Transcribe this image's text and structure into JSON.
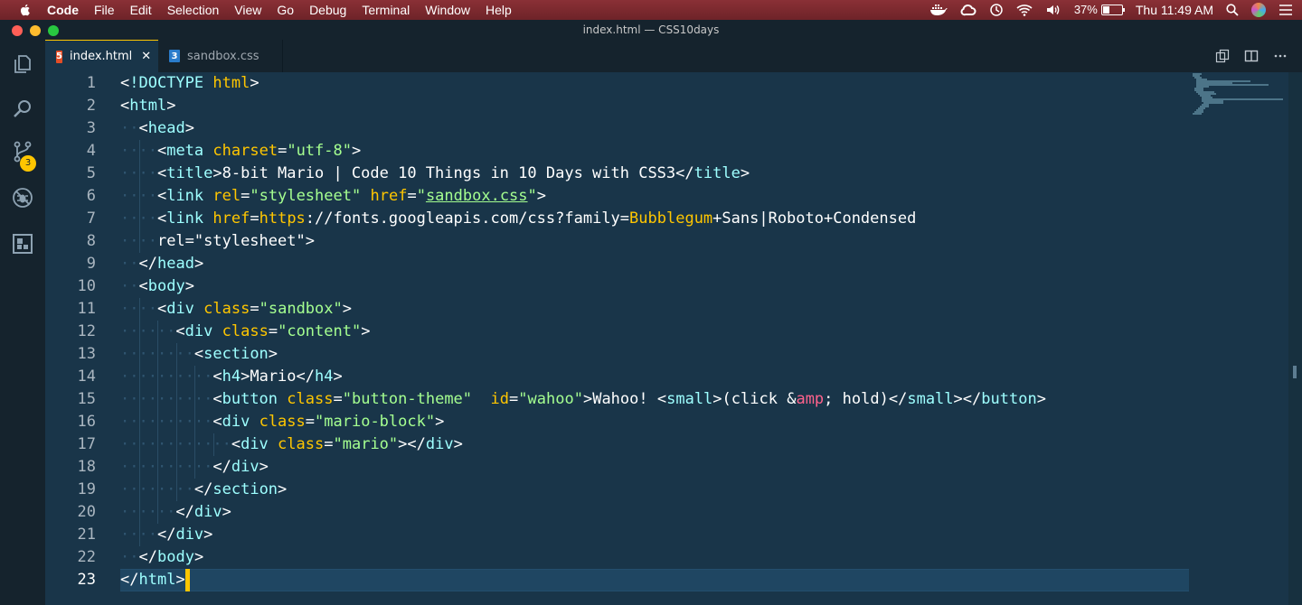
{
  "menubar": {
    "app": "Code",
    "items": [
      "File",
      "Edit",
      "Selection",
      "View",
      "Go",
      "Debug",
      "Terminal",
      "Window",
      "Help"
    ],
    "battery_text": "37%",
    "battery_level": 0.37,
    "clock": "Thu 11:49 AM"
  },
  "window": {
    "title": "index.html — CSS10days"
  },
  "tabs": [
    {
      "label": "index.html",
      "icon": "html5-icon",
      "active": true
    },
    {
      "label": "sandbox.css",
      "icon": "css3-icon",
      "active": false
    }
  ],
  "activity": {
    "scm_badge": "3"
  },
  "editor": {
    "line_numbers": [
      "1",
      "2",
      "3",
      "4",
      "5",
      "6",
      "7",
      "8",
      "9",
      "10",
      "11",
      "12",
      "13",
      "14",
      "15",
      "16",
      "17",
      "18",
      "19",
      "20",
      "21",
      "22",
      "23"
    ],
    "lines": [
      "<!DOCTYPE html>",
      "<html>",
      "  <head>",
      "    <meta charset=\"utf-8\">",
      "    <title>8-bit Mario | Code 10 Things in 10 Days with CSS3</title>",
      "    <link rel=\"stylesheet\" href=\"sandbox.css\">",
      "    <link href=\"https://fonts.googleapis.com/css?family=Bubblegum+Sans|Roboto+Condensed\"",
      "    rel=\"stylesheet\">",
      "  </head>",
      "  <body>",
      "    <div class=\"sandbox\">",
      "      <div class=\"content\">",
      "        <section>",
      "          <h4>Mario</h4>",
      "          <button class=\"button-theme\"  id=\"wahoo\">Wahoo! <small>(click &amp; hold)</small></button>",
      "          <div class=\"mario-block\">",
      "            <div class=\"mario\"></div>",
      "          </div>",
      "        </section>",
      "      </div>",
      "    </div>",
      "  </body>",
      "</html>"
    ],
    "current_line": 23
  },
  "colors": {
    "background": "#193549",
    "tag": "#9effff",
    "attribute": "#ffc600",
    "string": "#a5ff90",
    "entity": "#ff628c",
    "accent": "#ffc600"
  }
}
